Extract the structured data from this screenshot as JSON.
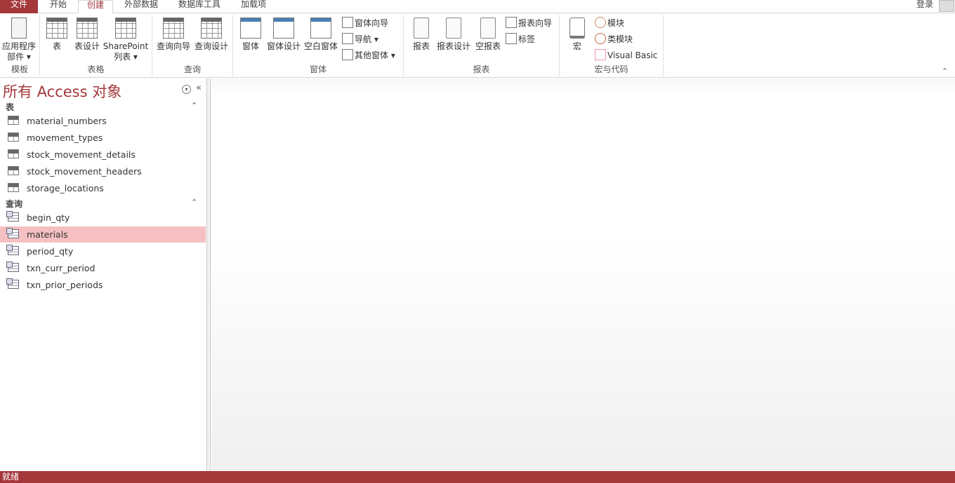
{
  "tabs": [
    {
      "label": "文件"
    },
    {
      "label": "开始"
    },
    {
      "label": "创建",
      "active": true
    },
    {
      "label": "外部数据"
    },
    {
      "label": "数据库工具"
    },
    {
      "label": "加载项"
    }
  ],
  "signin": "登录",
  "ribbon": {
    "groups": {
      "templates": "模板",
      "tables": "表格",
      "queries": "查询",
      "forms": "窗体",
      "reports": "报表",
      "macros": "宏与代码"
    },
    "app_parts": {
      "line1": "应用程序",
      "line2": "部件 ▾"
    },
    "table": "表",
    "table_design": "表设计",
    "sharepoint": {
      "line1": "SharePoint",
      "line2": "列表 ▾"
    },
    "query_wizard": "查询向导",
    "query_design": "查询设计",
    "form": "窗体",
    "form_design": "窗体设计",
    "blank_form": "空白窗体",
    "form_wizard": "窗体向导",
    "navigation": "导航 ▾",
    "more_forms": "其他窗体 ▾",
    "report": "报表",
    "report_design": "报表设计",
    "blank_report": "空报表",
    "report_wizard": "报表向导",
    "labels": "标签",
    "macro": "宏",
    "module": "模块",
    "class_module": "类模块",
    "visual_basic": "Visual Basic"
  },
  "nav": {
    "title": "所有 Access 对象",
    "tables_header": "表",
    "tables": [
      "material_numbers",
      "movement_types",
      "stock_movement_details",
      "stock_movement_headers",
      "storage_locations"
    ],
    "queries_header": "查询",
    "queries": [
      "begin_qty",
      "materials",
      "period_qty",
      "txn_curr_period",
      "txn_prior_periods"
    ],
    "selected": "materials"
  },
  "status": "就绪"
}
